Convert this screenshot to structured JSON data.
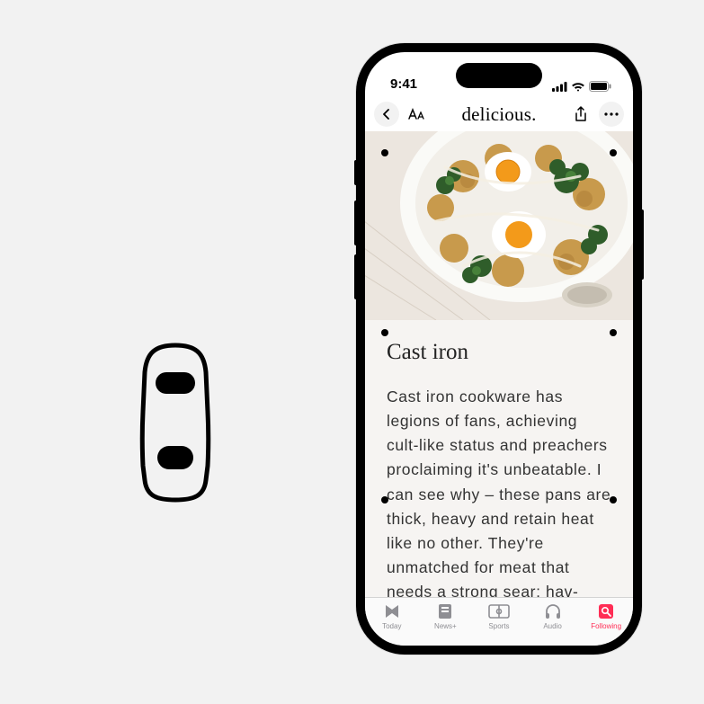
{
  "status_bar": {
    "time": "9:41"
  },
  "nav": {
    "title": "delicious."
  },
  "article": {
    "heading": "Cast iron",
    "body": "Cast iron cookware has legions of fans, achieving cult-like status and preachers proclaiming it's unbeatable. I can see why – these pans are thick, heavy and retain heat like no other. They're unmatched for meat that needs a strong sear; hav-"
  },
  "tabs": [
    {
      "label": "Today"
    },
    {
      "label": "News+"
    },
    {
      "label": "Sports"
    },
    {
      "label": "Audio"
    },
    {
      "label": "Following"
    }
  ],
  "colors": {
    "accent": "#ff2d55"
  }
}
